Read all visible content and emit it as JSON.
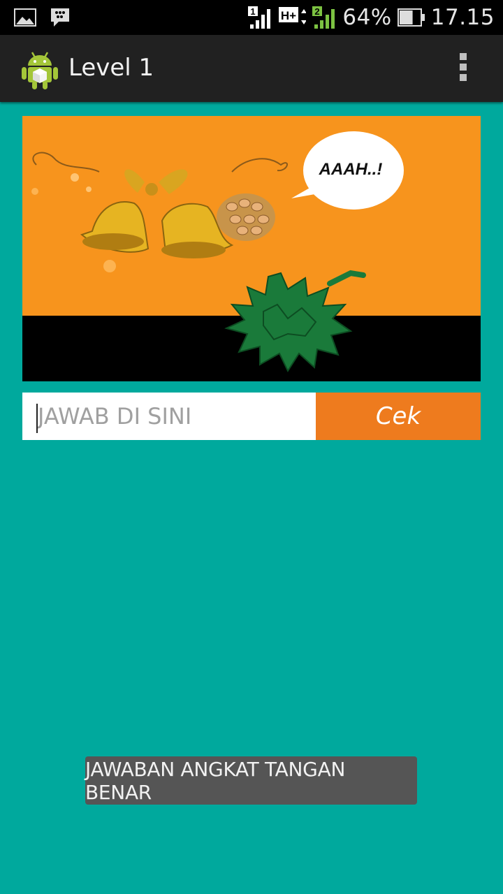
{
  "status_bar": {
    "icons": [
      "gallery-icon",
      "bbm-icon",
      "signal-sim1-icon",
      "hplus-icon",
      "signal-sim2-icon",
      "battery-icon"
    ],
    "sim1_label": "1",
    "network_label": "H+",
    "sim2_label": "2",
    "battery_percent": "64%",
    "battery_level": 0.64,
    "time": "17.15"
  },
  "action_bar": {
    "title": "Level 1",
    "app_icon": "android-robot-icon",
    "overflow_icon": "overflow-menu-icon"
  },
  "puzzle": {
    "speech_text": "AAAH..!",
    "colors": {
      "background": "#f7941d",
      "ground": "#000000",
      "durian": "#1a7a3a"
    }
  },
  "answer": {
    "placeholder": "JAWAB DI SINI",
    "value": "",
    "button_label": "Cek",
    "button_color": "#ee7b1e"
  },
  "toast": {
    "message": "JAWABAN ANGKAT TANGAN BENAR"
  },
  "colors": {
    "screen_bg": "#00a99d",
    "action_bar_bg": "#212121"
  }
}
